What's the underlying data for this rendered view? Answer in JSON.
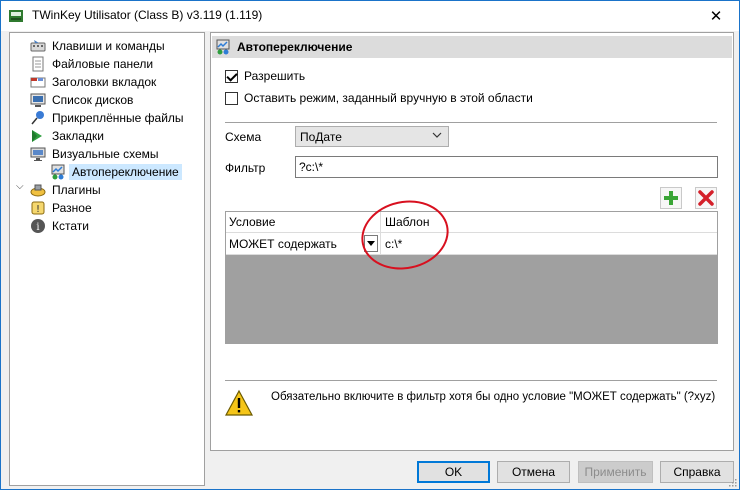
{
  "window": {
    "title": "TWinKey Utilisator (Class B) v3.119 (1.119)",
    "close_symbol": "✕"
  },
  "sidebar": {
    "items": [
      {
        "label": "Клавиши и команды",
        "icon": "keyboard-icon"
      },
      {
        "label": "Файловые панели",
        "icon": "file-panel-icon"
      },
      {
        "label": "Заголовки вкладок",
        "icon": "tab-titles-icon"
      },
      {
        "label": "Список дисков",
        "icon": "disk-list-icon"
      },
      {
        "label": "Прикреплённые файлы",
        "icon": "pin-icon"
      },
      {
        "label": "Закладки",
        "icon": "bookmark-icon"
      },
      {
        "label": "Визуальные схемы",
        "icon": "visual-schemes-icon"
      },
      {
        "label": "Автопереключение",
        "icon": "autoswitch-icon"
      },
      {
        "label": "Плагины",
        "icon": "plugins-icon"
      },
      {
        "label": "Разное",
        "icon": "misc-icon"
      },
      {
        "label": "Кстати",
        "icon": "info-icon"
      }
    ],
    "selected": "Автопереключение"
  },
  "panel": {
    "title": "Автопереключение",
    "allow_label": "Разрешить",
    "allow_checked": true,
    "keep_mode_label": "Оставить режим, заданный вручную в этой области",
    "keep_mode_checked": false,
    "scheme_label": "Схема",
    "scheme_value": "ПоДате",
    "filter_label": "Фильтр",
    "filter_value": "?c:\\*"
  },
  "grid": {
    "columns": [
      "Условие",
      "Шаблон"
    ],
    "rows": [
      {
        "condition": "МОЖЕТ содержать",
        "template": "c:\\*"
      }
    ]
  },
  "warning": {
    "text": "Обязательно включите в фильтр хотя бы одно условие \"МОЖЕТ содержать\" (?xyz)"
  },
  "buttons": {
    "ok": "OK",
    "cancel": "Отмена",
    "apply": "Применить",
    "help": "Справка"
  },
  "colors": {
    "selection": "#cce8ff",
    "annotation_circle": "#d8101f",
    "default_button_border": "#0078d7"
  }
}
